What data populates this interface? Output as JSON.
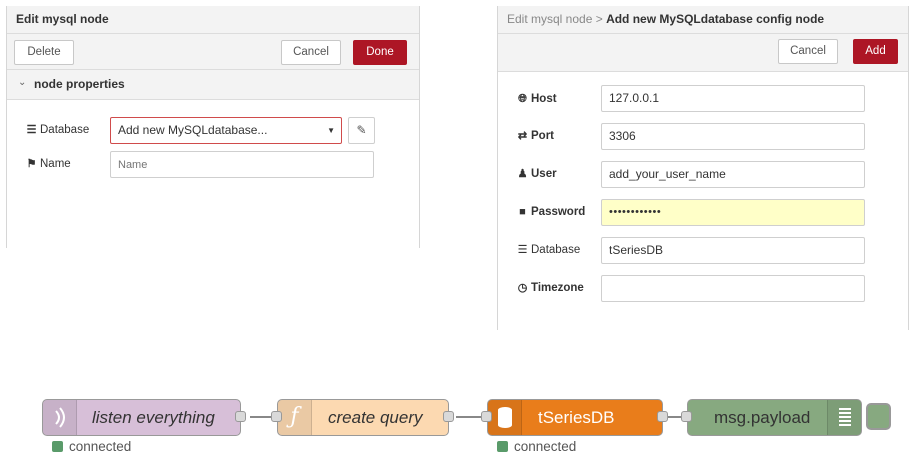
{
  "edit_node": {
    "title": "Edit mysql node",
    "delete_label": "Delete",
    "cancel_label": "Cancel",
    "done_label": "Done",
    "section_label": "node properties",
    "database_label": "Database",
    "database_value": "Add new MySQLdatabase...",
    "name_label": "Name",
    "name_placeholder": "Name"
  },
  "config_node": {
    "breadcrumb_parent": "Edit mysql node >",
    "breadcrumb_current": "Add new MySQLdatabase config node",
    "cancel_label": "Cancel",
    "add_label": "Add",
    "fields": {
      "host": {
        "label": "Host",
        "value": "127.0.0.1"
      },
      "port": {
        "label": "Port",
        "value": "3306"
      },
      "user": {
        "label": "User",
        "value": "add_your_user_name"
      },
      "password": {
        "label": "Password",
        "value": "••••••••••••"
      },
      "database": {
        "label": "Database",
        "value": "tSeriesDB"
      },
      "timezone": {
        "label": "Timezone",
        "value": ""
      }
    }
  },
  "flow": {
    "nodes": {
      "listen": {
        "label": "listen everything",
        "icon": "websocket-icon",
        "color": "#d7bfd8"
      },
      "query": {
        "label": "create query",
        "icon": "function-icon",
        "color": "#fcd9b1"
      },
      "db": {
        "label": "tSeriesDB",
        "icon": "database-icon",
        "color": "#e97d1b"
      },
      "debug": {
        "label": "msg.payload",
        "icon": "debug-icon",
        "color": "#87a980"
      }
    },
    "status_listen": "connected",
    "status_db": "connected"
  },
  "colors": {
    "accent_red": "#ad1625",
    "password_bg": "#ffffc8",
    "status_green": "#5a9b6a"
  }
}
